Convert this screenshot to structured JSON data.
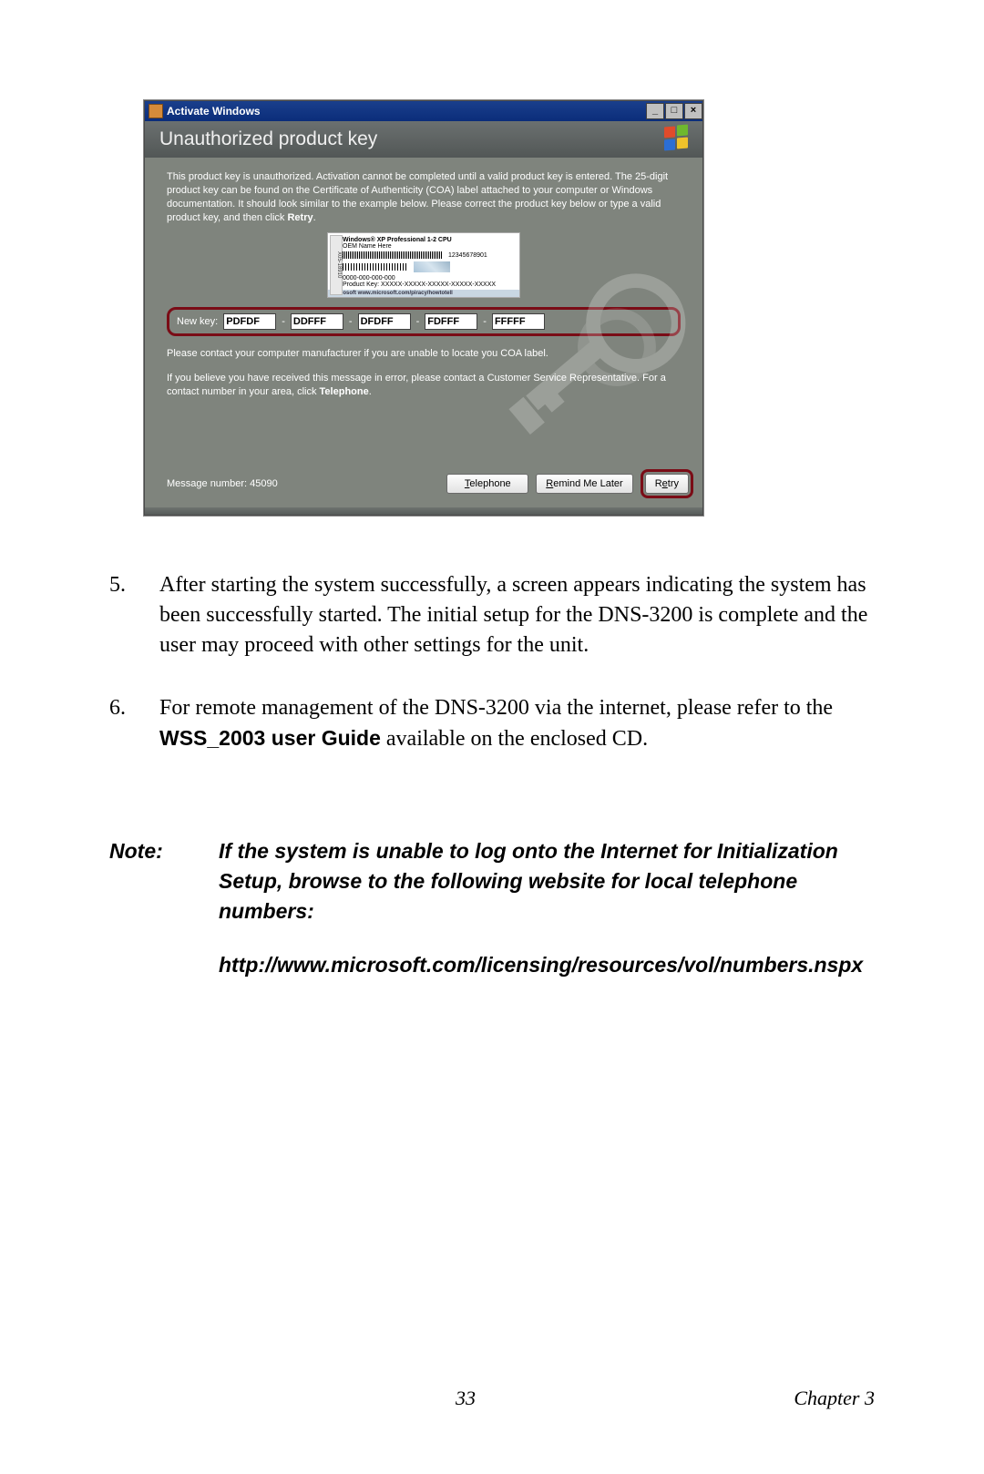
{
  "window": {
    "title": "Activate Windows",
    "min": "_",
    "max": "□",
    "close": "×"
  },
  "header": {
    "title": "Unauthorized product key"
  },
  "body": {
    "para1a": "This product key is unauthorized. Activation cannot be completed until a valid product key is entered. The 25-digit product key can be found on the Certificate of Authenticity (COA) label attached to your computer or Windows documentation. It should look similar to the example below. Please correct the product key below or type a valid product key, and then click ",
    "para1b": "Retry",
    "para1c": ".",
    "coa_top": "Windows® XP   Professional 1-2 CPU",
    "coa_oem": "OEM Name Here",
    "coa_pn": "12345678901",
    "coa_side": "X05-18910",
    "coa_mid": "0000-000-000-000",
    "coa_pkey": "Product Key: XXXXX-XXXXX-XXXXX-XXXXX-XXXXX",
    "coa_footer": "Microsoft  www.microsoft.com/piracy/howtotell",
    "newkey_label": "New key:",
    "key": [
      "PDFDF",
      "DDFFF",
      "DFDFF",
      "FDFFF",
      "FFFFF"
    ],
    "para2": "Please contact your computer manufacturer if you are unable to locate you COA label.",
    "para3a": "If you believe you have received this message in error, please contact a Customer Service Representative. For a contact number in your area, click ",
    "para3b": "Telephone",
    "para3c": ".",
    "msgnum": "Message number: 45090"
  },
  "buttons": {
    "telephone": "Telephone",
    "remind": "Remind Me Later",
    "retry": "Retry"
  },
  "doc": {
    "n5": "5.",
    "t5": "After starting the system successfully, a screen appears indicating the system has been successfully started. The initial setup for the DNS-3200 is complete and the user may proceed with other settings for the unit.",
    "n6": "6.",
    "t6a": "For remote management of the DNS-3200 via the internet, please refer to the ",
    "t6b": "WSS_2003 user Guide",
    "t6c": " available on the enclosed CD.",
    "note_label": "Note:",
    "note_body": "If the system is unable to log onto the Internet for Initialization Setup, browse to the following website for local telephone numbers:",
    "note_url": "http://www.microsoft.com/licensing/resources/vol/numbers.nspx"
  },
  "footer": {
    "page": "33",
    "chapter": "Chapter 3"
  }
}
